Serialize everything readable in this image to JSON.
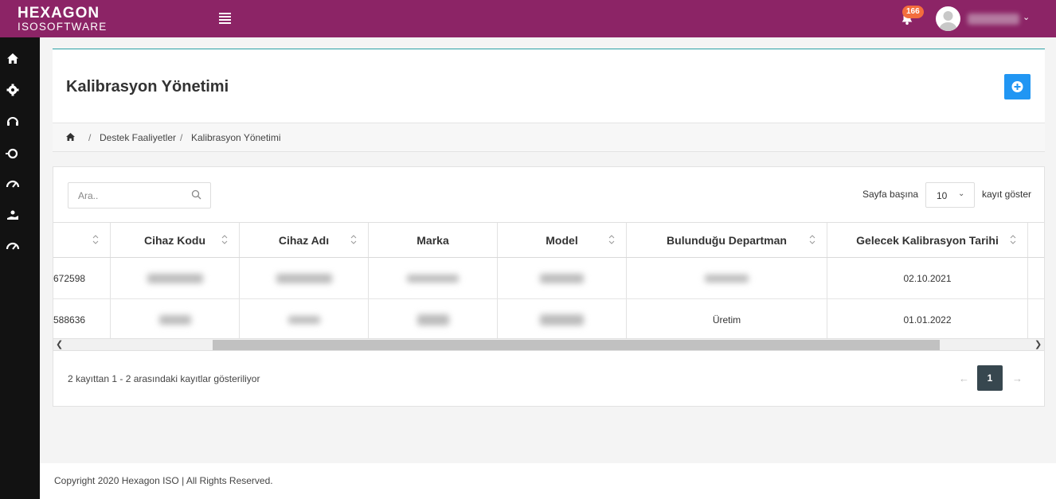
{
  "brand": {
    "line1": "HEXAGON",
    "line2": "ISOSOFTWARE"
  },
  "topbar": {
    "notification_count": "166"
  },
  "sidebar": {
    "icons": [
      "home-icon",
      "gear-icon",
      "headset-icon",
      "settings-alt-icon",
      "gauge-icon",
      "hand-icon",
      "gauge-alt-icon"
    ]
  },
  "page": {
    "title": "Kalibrasyon Yönetimi",
    "breadcrumb": [
      "Destek Faaliyetler",
      "Kalibrasyon Yönetimi"
    ]
  },
  "table_controls": {
    "search_placeholder": "Ara..",
    "per_page_label": "Sayfa başına",
    "per_page_value": "10",
    "show_label": "kayıt göster"
  },
  "table": {
    "columns": [
      "",
      "Cihaz Kodu",
      "Cihaz Adı",
      "Marka",
      "Model",
      "Bulunduğu Departman",
      "Gelecek Kalibrasyon Tarihi"
    ],
    "rows": [
      {
        "id": "672598",
        "department": "",
        "date": "02.10.2021"
      },
      {
        "id": "588636",
        "department": "Üretim",
        "date": "01.01.2022"
      }
    ]
  },
  "pagination": {
    "info": "2 kayıttan 1 - 2 arasındaki kayıtlar gösteriliyor",
    "prev": "←",
    "current": "1",
    "next": "→"
  },
  "footer": {
    "text": "Copyright 2020 Hexagon ISO | All Rights Reserved."
  },
  "colors": {
    "topbar": "#8c2466",
    "accent": "#2196f3",
    "sidebar": "#121212",
    "badge": "#f36d3d"
  }
}
